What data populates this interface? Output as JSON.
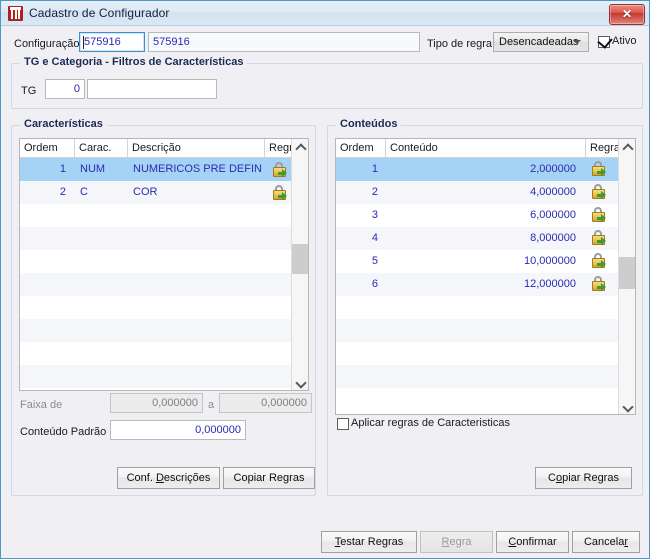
{
  "window": {
    "title": "Cadastro de Configurador",
    "icon": "app-icon",
    "close_label": "✕"
  },
  "header": {
    "configuracao_label": "Configuração",
    "configuracao_code": "575916",
    "configuracao_desc": "575916",
    "tipo_regra_label": "Tipo de regra",
    "tipo_regra_value": "Desencadeadas",
    "ativo_label": "Ativo",
    "ativo_checked": true
  },
  "filtros": {
    "group_title": "TG e Categoria - Filtros de Características",
    "tg_label": "TG",
    "tg_value": "0",
    "tg_desc": ""
  },
  "caracteristicas": {
    "group_title": "Características",
    "columns": [
      "Ordem",
      "Carac.",
      "Descrição",
      "Regra"
    ],
    "rows": [
      {
        "ordem": "1",
        "carac": "NUM",
        "descricao": "NUMERICOS PRE DEFINI",
        "regra": "lock-arrow-icon",
        "selected": true
      },
      {
        "ordem": "2",
        "carac": "C",
        "descricao": "COR",
        "regra": "lock-arrow-icon",
        "selected": false
      }
    ],
    "empty_rows": 8,
    "faixa_label": "Faixa de",
    "faixa_de": "0,000000",
    "faixa_a_label": "a",
    "faixa_ate": "0,000000",
    "conteudo_padrao_label": "Conteúdo Padrão",
    "conteudo_padrao_value": "0,000000",
    "btn_conf_descricoes": "Conf. Descrições",
    "btn_copiar_regras": "Copiar Regras"
  },
  "conteudos": {
    "group_title": "Conteúdos",
    "columns": [
      "Ordem",
      "Conteúdo",
      "Regra"
    ],
    "rows": [
      {
        "ordem": "1",
        "conteudo": "2,000000",
        "regra": "lock-arrow-icon",
        "selected": true
      },
      {
        "ordem": "2",
        "conteudo": "4,000000",
        "regra": "lock-arrow-icon",
        "selected": false
      },
      {
        "ordem": "3",
        "conteudo": "6,000000",
        "regra": "lock-arrow-icon",
        "selected": false
      },
      {
        "ordem": "4",
        "conteudo": "8,000000",
        "regra": "lock-arrow-icon",
        "selected": false
      },
      {
        "ordem": "5",
        "conteudo": "10,000000",
        "regra": "lock-arrow-icon",
        "selected": false
      },
      {
        "ordem": "6",
        "conteudo": "12,000000",
        "regra": "lock-arrow-icon",
        "selected": false
      }
    ],
    "empty_rows": 5,
    "aplicar_label": "Aplicar regras de Caracteristicas",
    "aplicar_checked": false,
    "btn_copiar_regras": "Copiar Regras"
  },
  "footer": {
    "btn_testar_regras": "Testar Regras",
    "btn_regra": "Regra",
    "btn_regra_disabled": true,
    "btn_confirmar": "Confirmar",
    "btn_cancelar": "Cancelar"
  },
  "colors": {
    "accent_selection": "#a5d3f5",
    "text_value": "#2a2ab4",
    "group_title": "#1c2b55",
    "window_bg": "#f0f0f4",
    "close_button": "#c4372d"
  }
}
